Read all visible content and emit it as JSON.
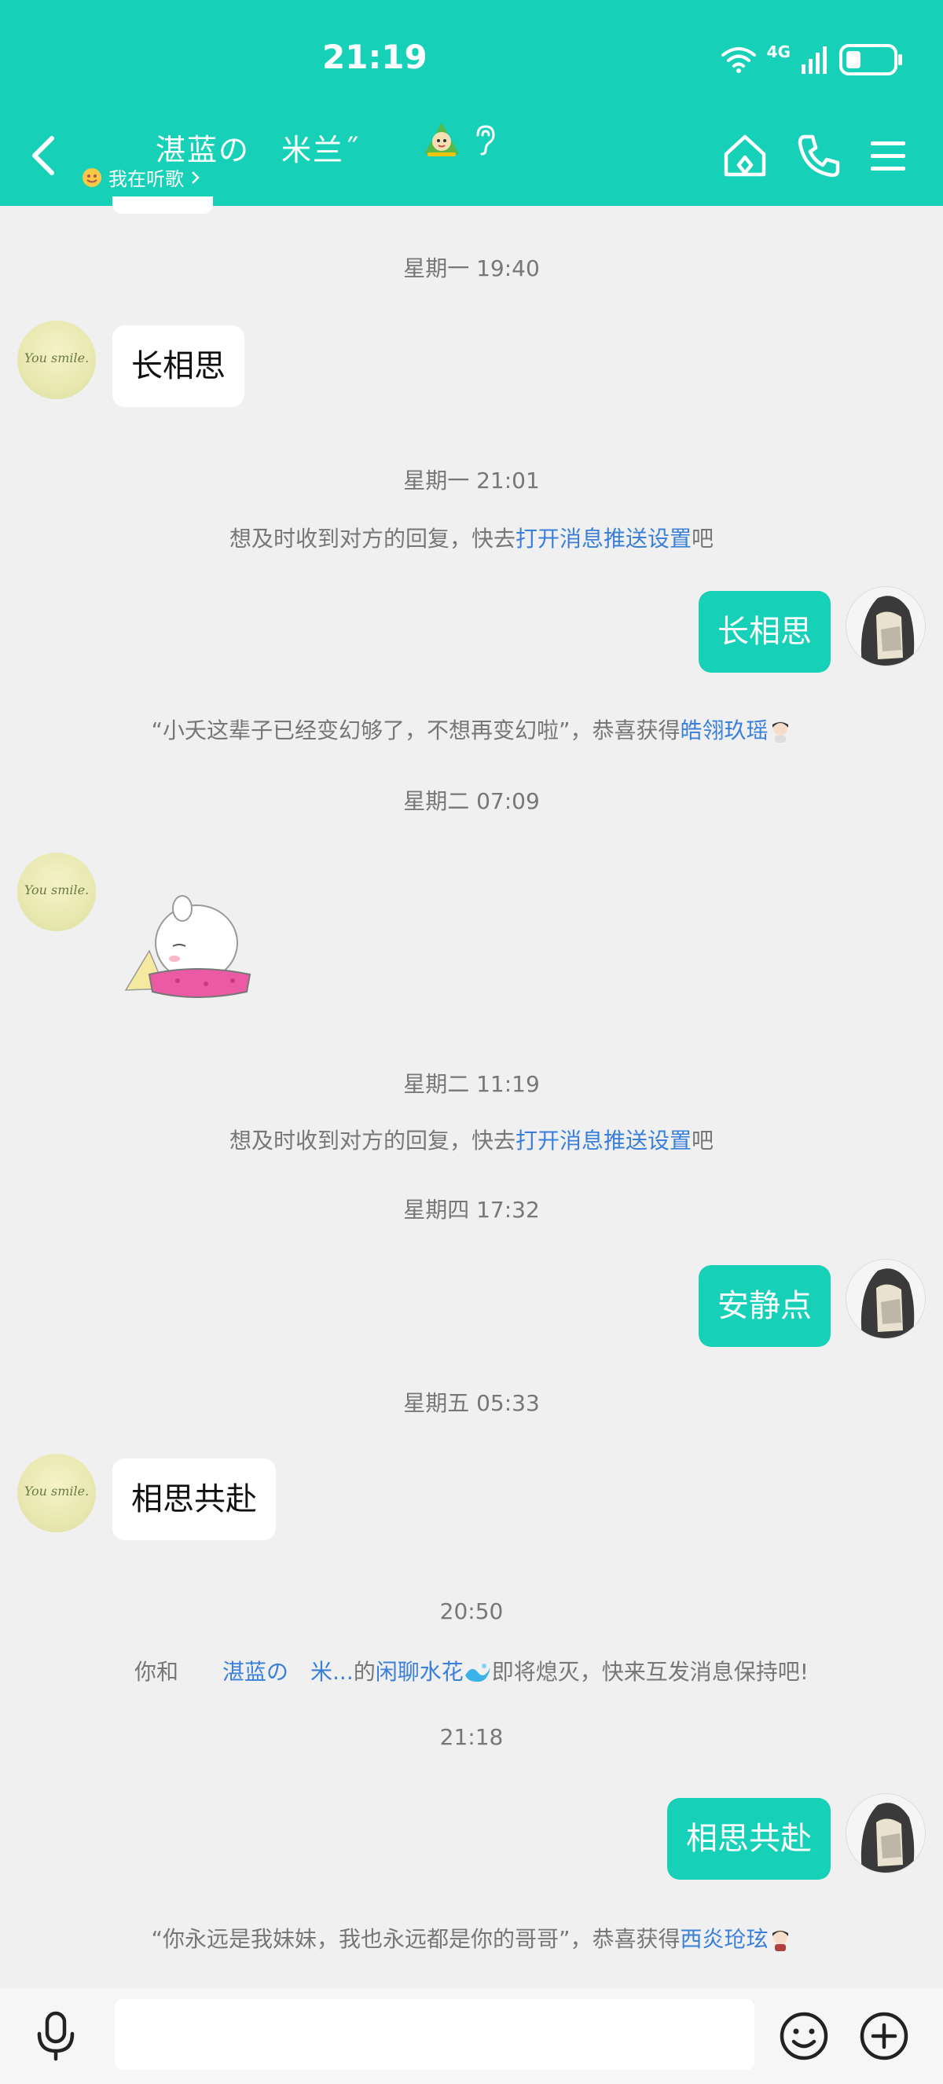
{
  "status_bar": {
    "time": "21:19",
    "network": "4G"
  },
  "header": {
    "title": "湛蓝の　米兰˝",
    "status_text": "我在听歌",
    "colors": {
      "accent": "#16d1b8",
      "link": "#3a7fd9"
    }
  },
  "messages": {
    "ts1": "星期一 19:40",
    "m1": "长相思",
    "ts2": "星期一 21:01",
    "sys1": {
      "pre": "想及时收到对方的回复，快去",
      "link": "打开消息推送设置",
      "post": "吧"
    },
    "m2": "长相思",
    "sys2": {
      "pre": "“小夭这辈子已经变幻够了，不想再变幻啦”，恭喜获得",
      "link": "皓翎玖瑶"
    },
    "ts3": "星期二 07:09",
    "ts4": "星期二 11:19",
    "sys3": {
      "pre": "想及时收到对方的回复，快去",
      "link": "打开消息推送设置",
      "post": "吧"
    },
    "ts5": "星期四 17:32",
    "m3": "安静点",
    "ts6": "星期五 05:33",
    "m4": "相思共赴",
    "ts7": "20:50",
    "sys4": {
      "pre": "你和　　",
      "link1": "湛蓝の　米...",
      "mid": "的",
      "link2": "闲聊水花",
      "post": "即将熄灭，快来互发消息保持吧!"
    },
    "ts8": "21:18",
    "m5": "相思共赴",
    "sys5": {
      "pre": "“你永远是我妹妹，我也永远都是你的哥哥”，恭喜获得",
      "link": "西炎玱玹"
    }
  },
  "avatars": {
    "other_text": "You smile."
  },
  "input": {
    "placeholder": ""
  },
  "icons": [
    "back-arrow-icon",
    "home-icon",
    "phone-icon",
    "menu-icon",
    "mic-icon",
    "emoji-icon",
    "plus-icon",
    "wifi-icon",
    "signal-icon",
    "battery-icon"
  ]
}
